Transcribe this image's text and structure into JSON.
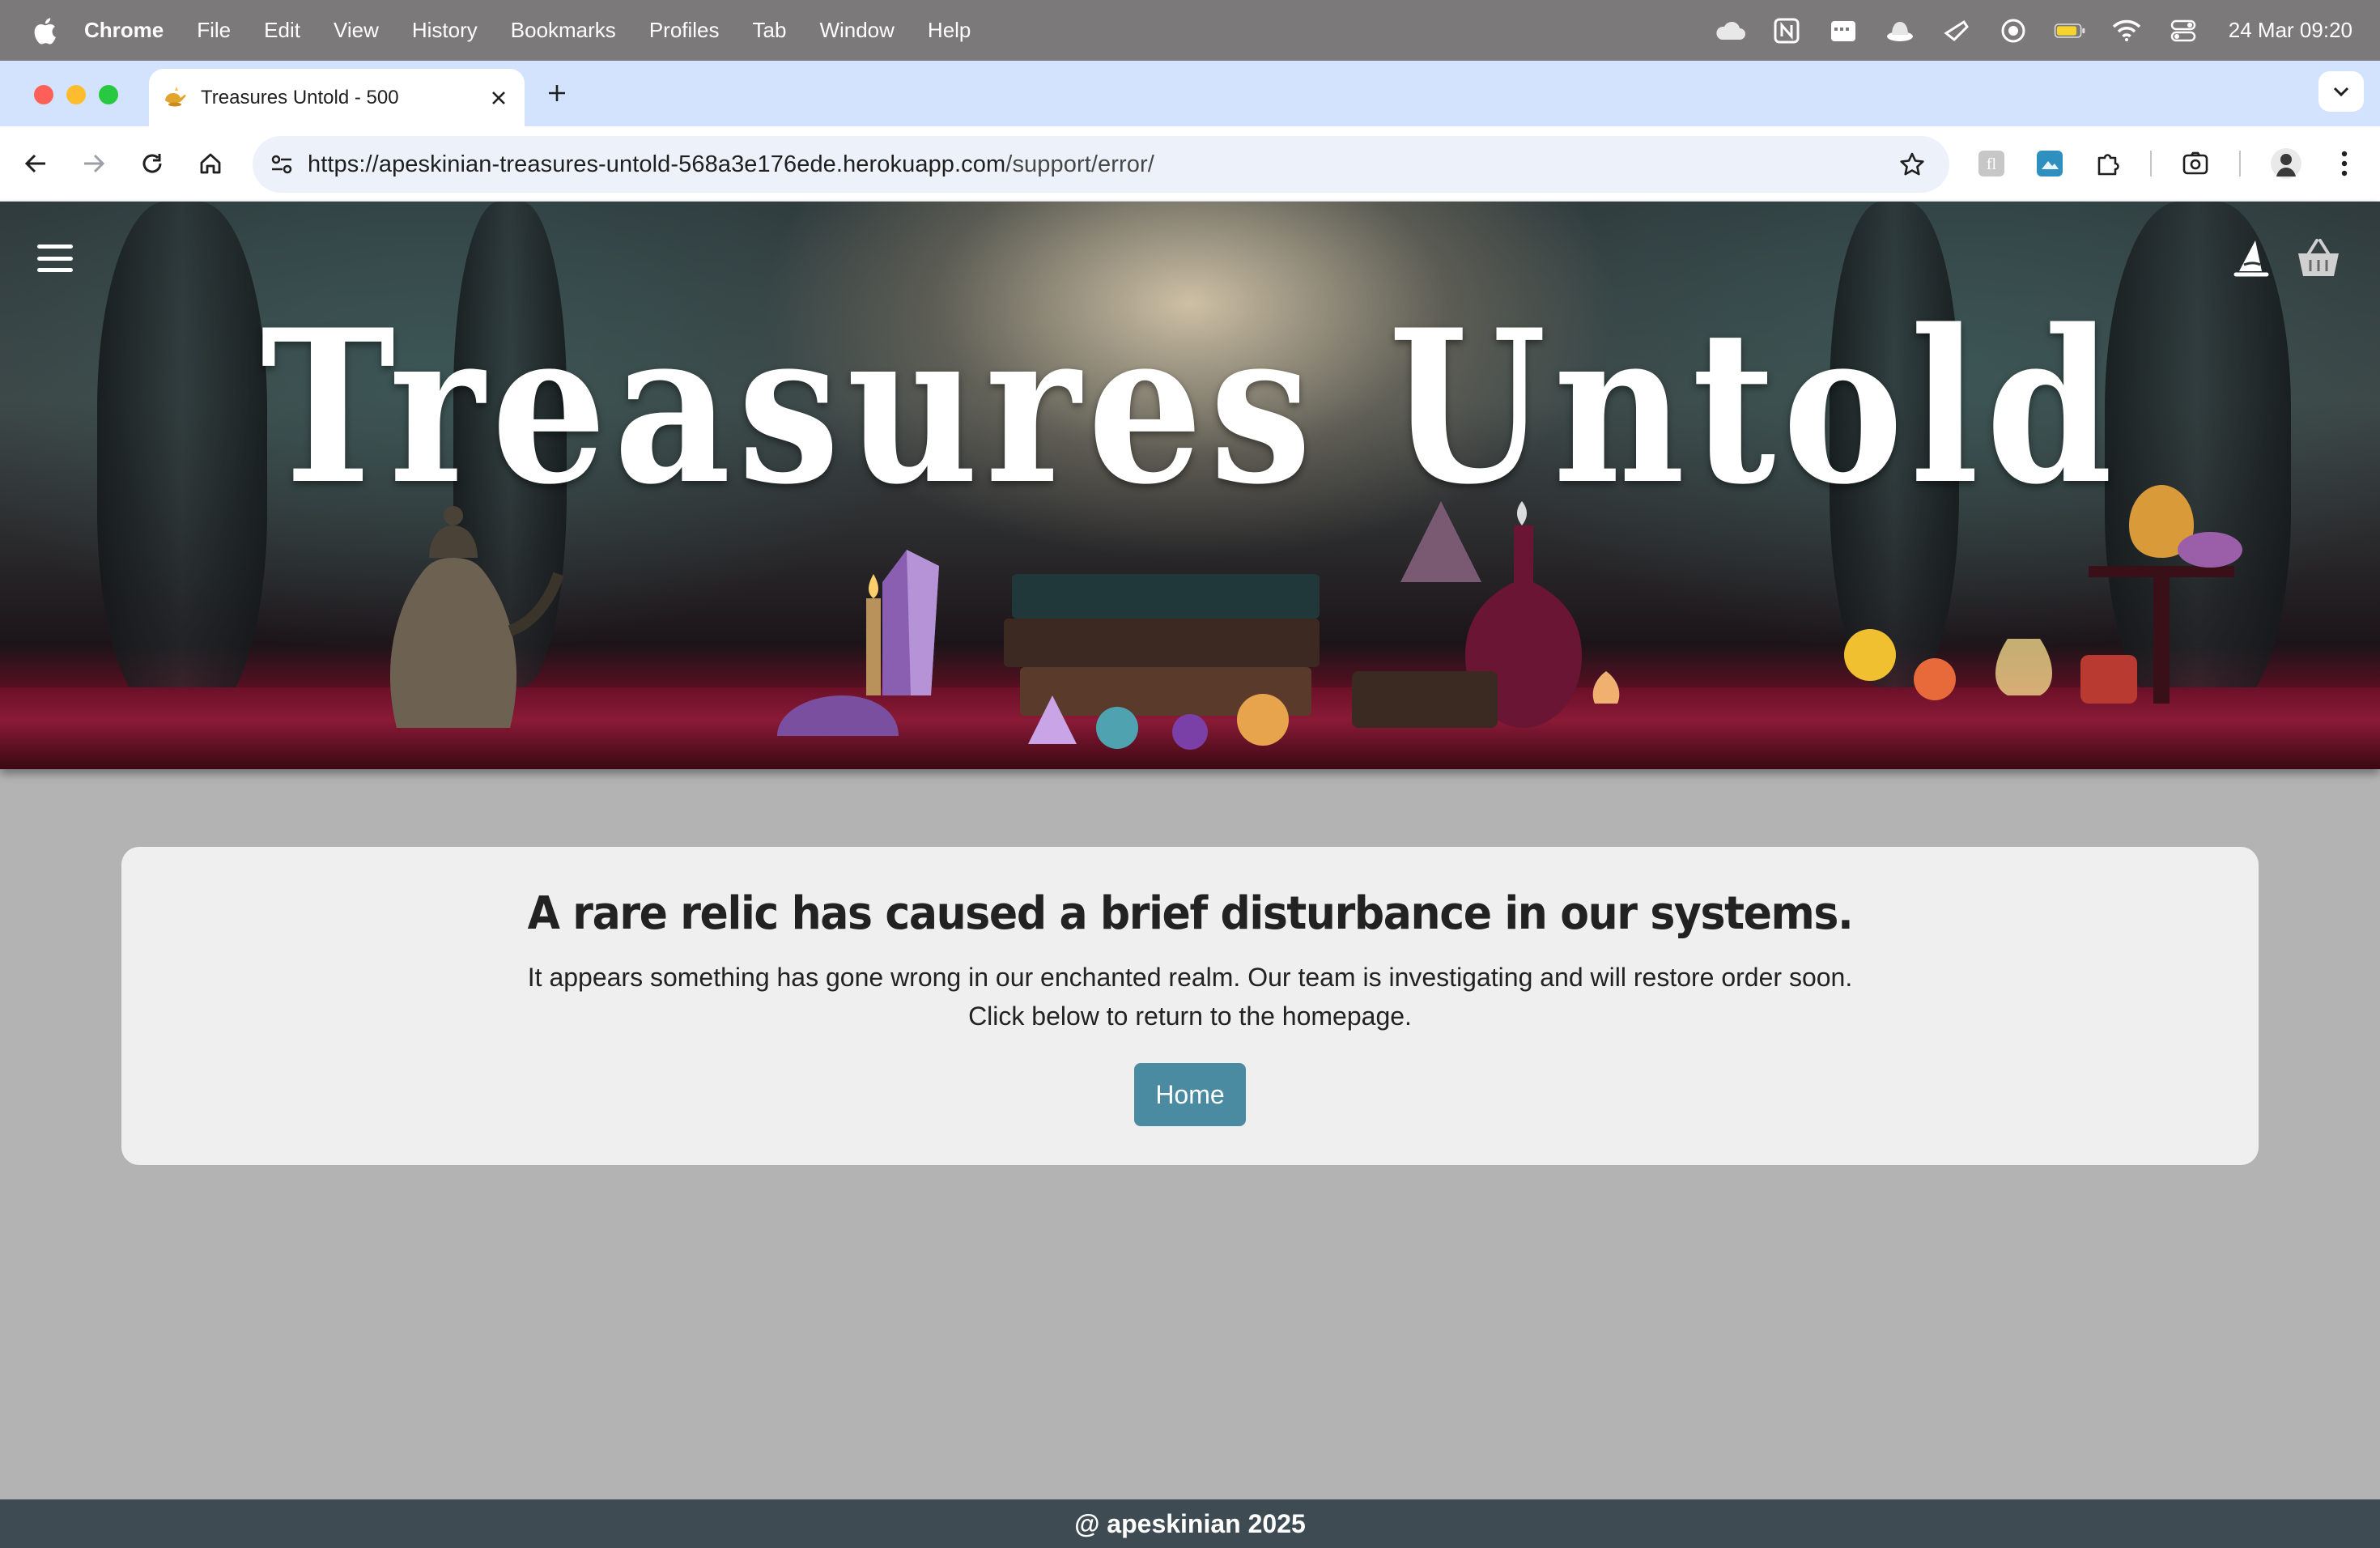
{
  "menubar": {
    "app_name": "Chrome",
    "items": [
      "File",
      "Edit",
      "View",
      "History",
      "Bookmarks",
      "Profiles",
      "Tab",
      "Window",
      "Help"
    ],
    "clock": "24 Mar  09:20",
    "status_icons": [
      "cloud-icon",
      "notion-icon",
      "calendar-icon",
      "hat-icon",
      "share-icon",
      "record-icon",
      "battery-icon",
      "wifi-icon",
      "control-center-icon"
    ]
  },
  "browser": {
    "tab_title": "Treasures Untold - 500",
    "url_host": "https://apeskinian-treasures-untold-568a3e176ede.herokuapp.com",
    "url_path": "/support/error/"
  },
  "site": {
    "brand": "Treasures Untold",
    "accent_color": "#4b8ba2",
    "footer_color": "#3f4b52"
  },
  "error": {
    "heading": "A rare relic has caused a brief disturbance in our systems.",
    "line1": "It appears something has gone wrong in our enchanted realm. Our team is investigating and will restore order soon.",
    "line2": "Click below to return to the homepage.",
    "button_label": "Home"
  },
  "footer": {
    "text": "@ apeskinian 2025"
  }
}
